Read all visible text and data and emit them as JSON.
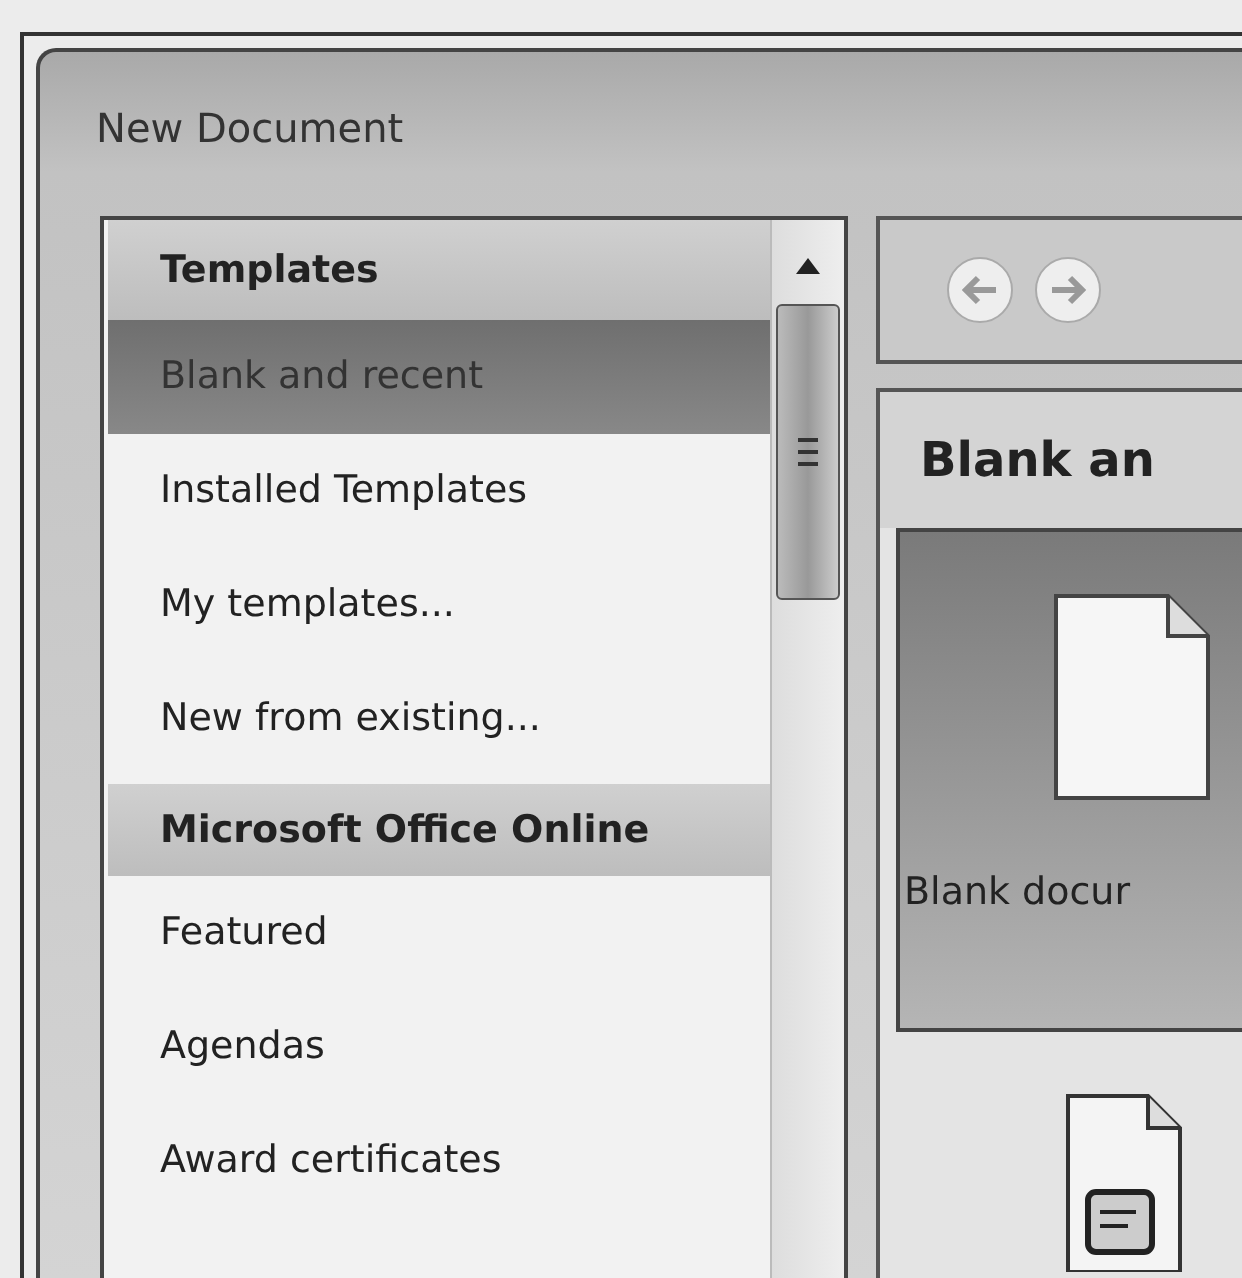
{
  "window": {
    "title": "New Document"
  },
  "sidebar": {
    "items": [
      {
        "kind": "header",
        "label": "Templates"
      },
      {
        "kind": "item",
        "label": "Blank and recent",
        "selected": true
      },
      {
        "kind": "item",
        "label": "Installed Templates",
        "selected": false
      },
      {
        "kind": "item",
        "label": "My templates...",
        "selected": false
      },
      {
        "kind": "item",
        "label": "New from existing...",
        "selected": false
      },
      {
        "kind": "header",
        "label": "Microsoft Office Online"
      },
      {
        "kind": "item",
        "label": "Featured",
        "selected": false
      },
      {
        "kind": "item",
        "label": "Agendas",
        "selected": false
      },
      {
        "kind": "item",
        "label": "Award certificates",
        "selected": false
      }
    ]
  },
  "content": {
    "heading": "Blank an",
    "tiles": [
      {
        "label": "Blank docur",
        "selected": true
      }
    ]
  }
}
